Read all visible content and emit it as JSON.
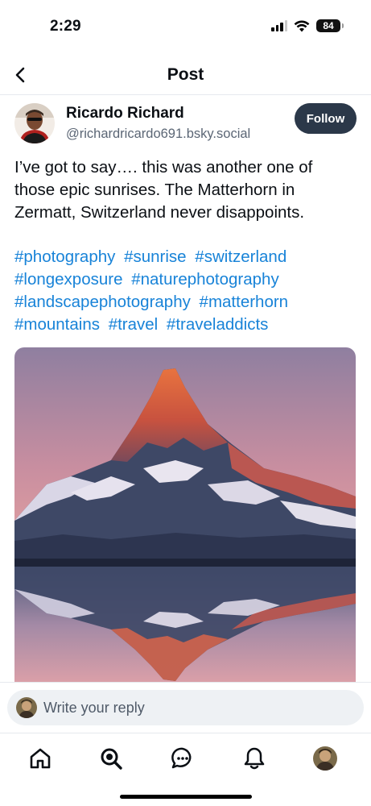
{
  "status_bar": {
    "time": "2:29",
    "battery": "84",
    "icons": [
      "signal-icon",
      "wifi-icon",
      "battery-icon"
    ]
  },
  "header": {
    "title": "Post",
    "back_icon": "chevron-left-icon"
  },
  "post": {
    "author_name": "Ricardo Richard",
    "author_handle": "@richardricardo691.bsky.social",
    "follow_label": "Follow",
    "text": "I’ve got to say…. this was another one of those epic sunrises. The Matterhorn in Zermatt, Switzerland never disappoints.",
    "hashtags": [
      "#photography",
      "#sunrise",
      "#switzerland",
      "#longexposure",
      "#naturephotography",
      "#landscapephotography",
      "#matterhorn",
      "#mountains",
      "#travel",
      "#traveladdicts"
    ],
    "image_icon": "matterhorn-photo"
  },
  "reply": {
    "placeholder": "Write your reply"
  },
  "tab_bar": {
    "items": [
      {
        "icon": "home-icon"
      },
      {
        "icon": "search-icon"
      },
      {
        "icon": "chat-icon"
      },
      {
        "icon": "bell-icon"
      },
      {
        "icon": "profile-avatar"
      }
    ]
  },
  "colors": {
    "link": "#1883d8",
    "follow_bg": "#2b3849",
    "muted": "#5b6675"
  }
}
